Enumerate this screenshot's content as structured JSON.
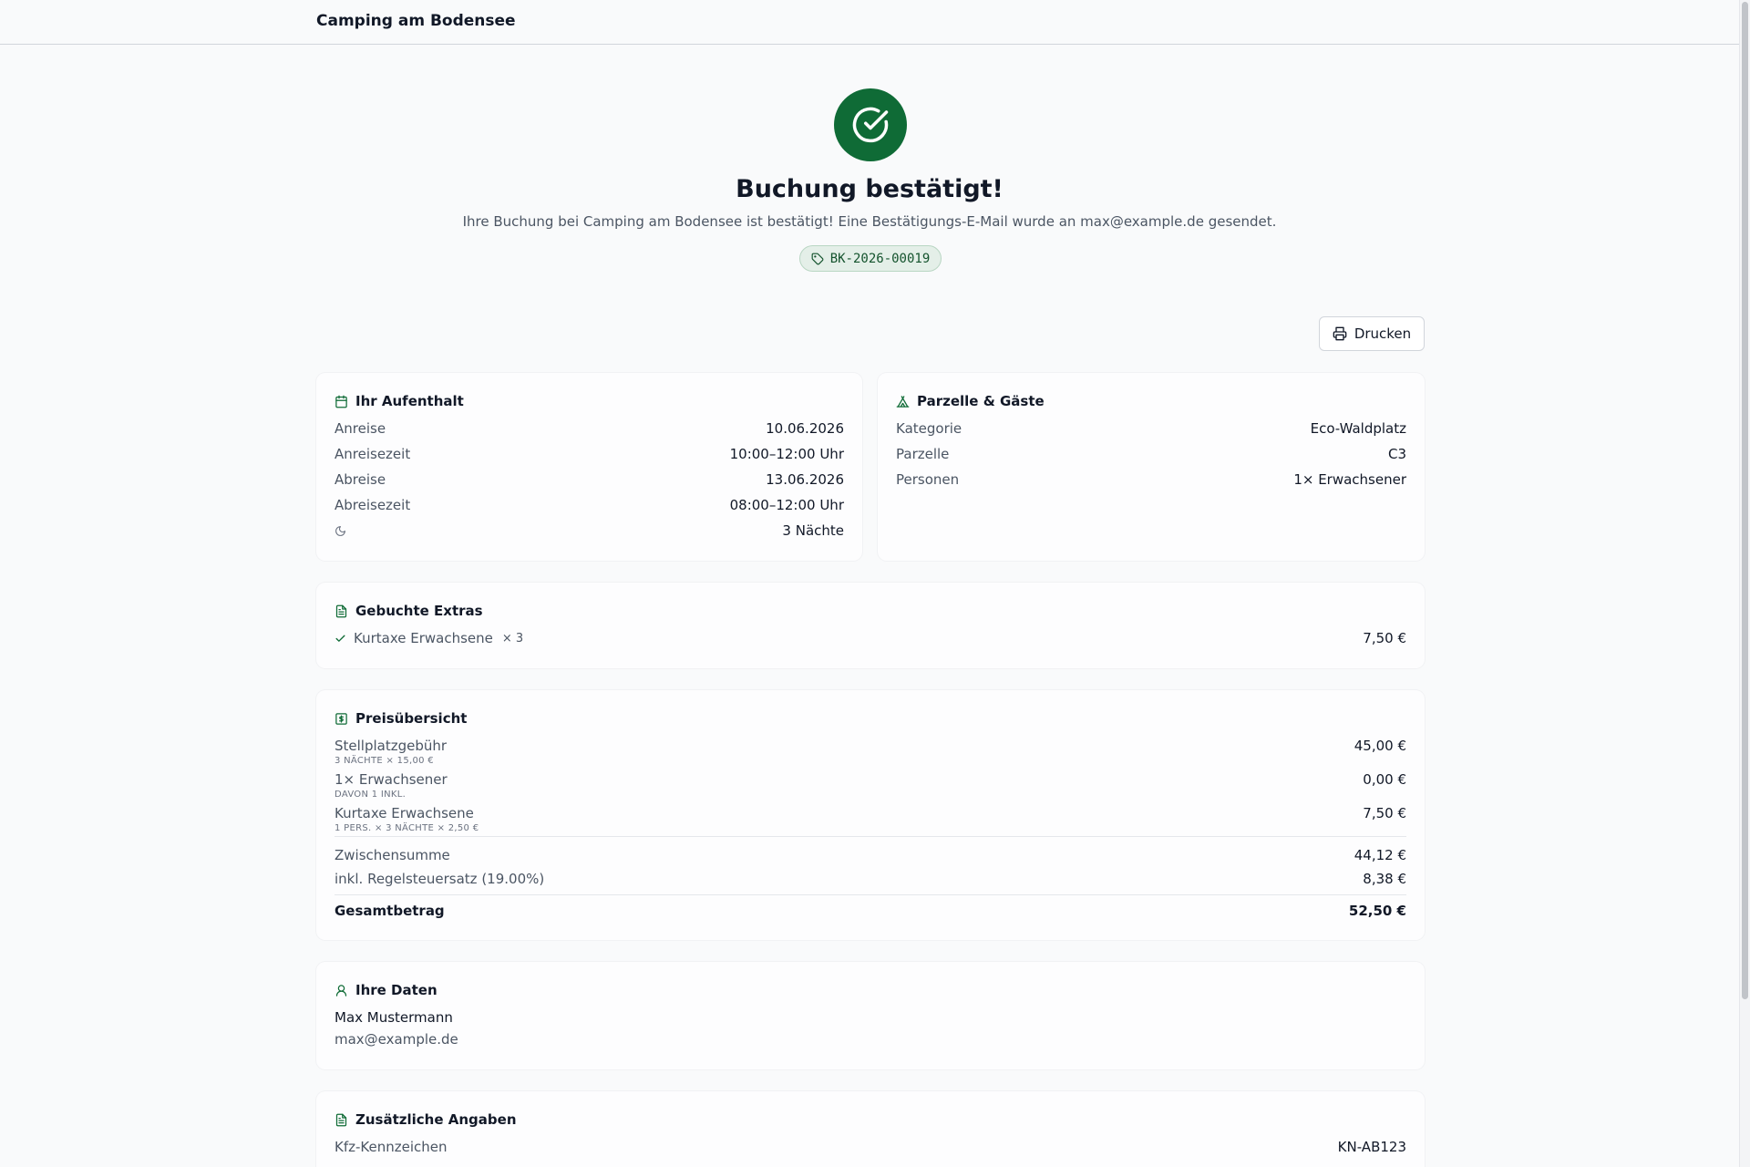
{
  "app": {
    "title": "Camping am Bodensee"
  },
  "hero": {
    "title": "Buchung bestätigt!",
    "message": "Ihre Buchung bei Camping am Bodensee ist bestätigt! Eine Bestätigungs-E-Mail wurde an max@example.de gesendet.",
    "booking_ref": "BK-2026-00019",
    "icon": "check-circle-icon",
    "accent_color": "#0f6b36"
  },
  "actions": {
    "print_label": "Drucken"
  },
  "stay": {
    "title": "Ihr Aufenthalt",
    "rows": [
      {
        "label": "Anreise",
        "value": "10.06.2026"
      },
      {
        "label": "Anreisezeit",
        "value": "10:00–12:00 Uhr"
      },
      {
        "label": "Abreise",
        "value": "13.06.2026"
      },
      {
        "label": "Abreisezeit",
        "value": "08:00–12:00 Uhr"
      }
    ],
    "nights": "3 Nächte"
  },
  "pitch": {
    "title": "Parzelle & Gäste",
    "rows": [
      {
        "label": "Kategorie",
        "value": "Eco-Waldplatz"
      },
      {
        "label": "Parzelle",
        "value": "C3"
      },
      {
        "label": "Personen",
        "value": "1× Erwachsener"
      }
    ]
  },
  "extras": {
    "title": "Gebuchte Extras",
    "items": [
      {
        "name": "Kurtaxe Erwachsene",
        "qty": "× 3",
        "price": "7,50 €"
      }
    ]
  },
  "pricing": {
    "title": "Preisübersicht",
    "lines": [
      {
        "label": "Stellplatzgebühr",
        "detail": "3 Nächte × 15,00 €",
        "amount": "45,00 €"
      },
      {
        "label": "1× Erwachsener",
        "detail": "davon 1 inkl.",
        "amount": "0,00 €"
      },
      {
        "label": "Kurtaxe Erwachsene",
        "detail": "1 Pers. × 3 Nächte × 2,50 €",
        "amount": "7,50 €"
      }
    ],
    "subtotal_label": "Zwischensumme",
    "subtotal": "44,12 €",
    "tax_label": "inkl. Regelsteuersatz (19.00%)",
    "tax": "8,38 €",
    "total_label": "Gesamtbetrag",
    "total": "52,50 €"
  },
  "customer": {
    "title": "Ihre Daten",
    "name": "Max Mustermann",
    "email": "max@example.de"
  },
  "additional": {
    "title": "Zusätzliche Angaben",
    "rows": [
      {
        "label": "Kfz-Kennzeichen",
        "value": "KN-AB123"
      }
    ]
  }
}
